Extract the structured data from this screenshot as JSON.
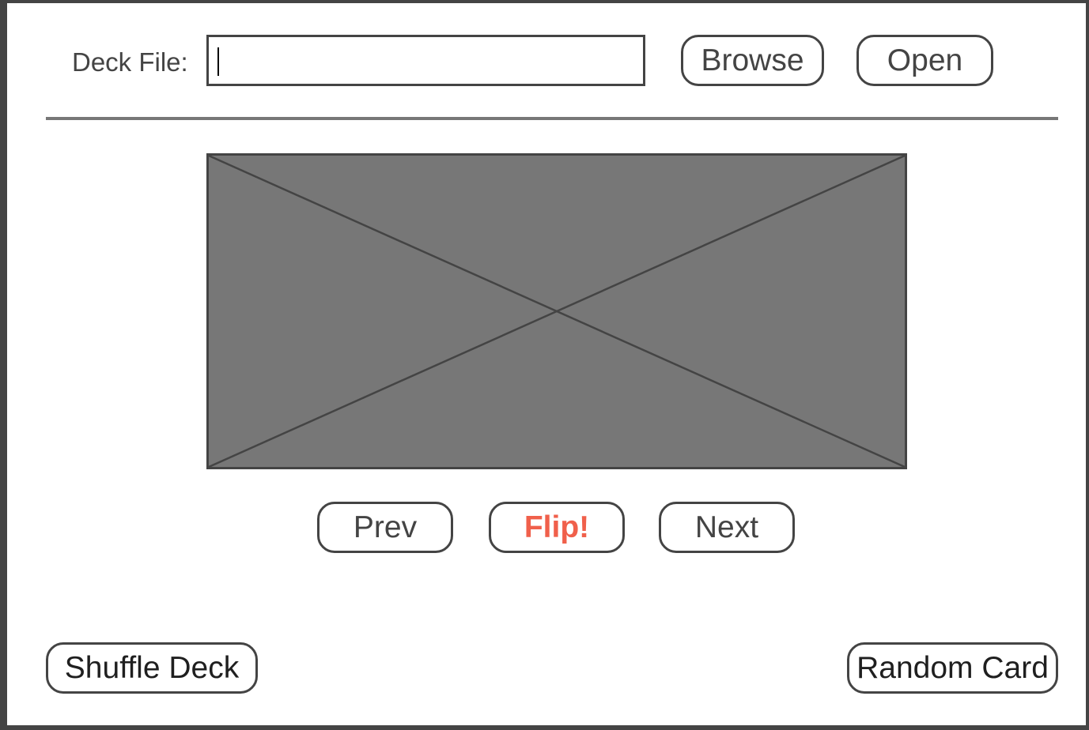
{
  "header": {
    "deck_file_label": "Deck File:",
    "deck_file_value": "",
    "browse_label": "Browse",
    "open_label": "Open"
  },
  "card": {
    "image_alt": "card-image-placeholder"
  },
  "navigation": {
    "prev_label": "Prev",
    "flip_label": "Flip!",
    "next_label": "Next"
  },
  "footer": {
    "shuffle_label": "Shuffle Deck",
    "random_label": "Random Card"
  },
  "colors": {
    "border": "#444444",
    "placeholder_fill": "#777777",
    "flip_accent": "#f0604b",
    "divider": "#777777"
  }
}
